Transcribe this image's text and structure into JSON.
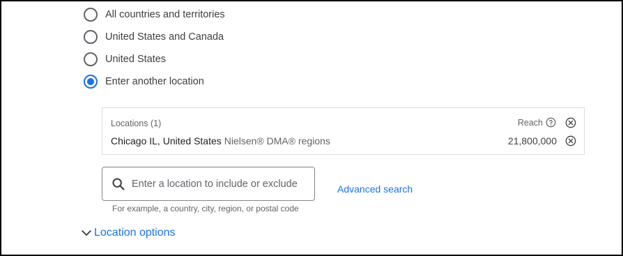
{
  "location_targeting": {
    "options": [
      {
        "label": "All countries and territories",
        "selected": false
      },
      {
        "label": "United States and Canada",
        "selected": false
      },
      {
        "label": "United States",
        "selected": false
      },
      {
        "label": "Enter another location",
        "selected": true
      }
    ],
    "locations_panel": {
      "header": "Locations (1)",
      "reach_label": "Reach",
      "items": [
        {
          "name": "Chicago IL, United States",
          "type": "Nielsen® DMA® regions",
          "reach": "21,800,000"
        }
      ]
    },
    "search": {
      "placeholder": "Enter a location to include or exclude",
      "value": "",
      "helper": "For example, a country, city, region, or postal code"
    },
    "advanced_search_label": "Advanced search",
    "location_options_label": "Location options"
  },
  "colors": {
    "accent": "#1a73e8",
    "text_primary": "#202124",
    "text_secondary": "#5f6368",
    "border": "#dadce0",
    "frame": "#000000"
  },
  "icons": [
    "help-circle-icon",
    "remove-circle-icon",
    "search-icon",
    "chevron-down-icon"
  ]
}
